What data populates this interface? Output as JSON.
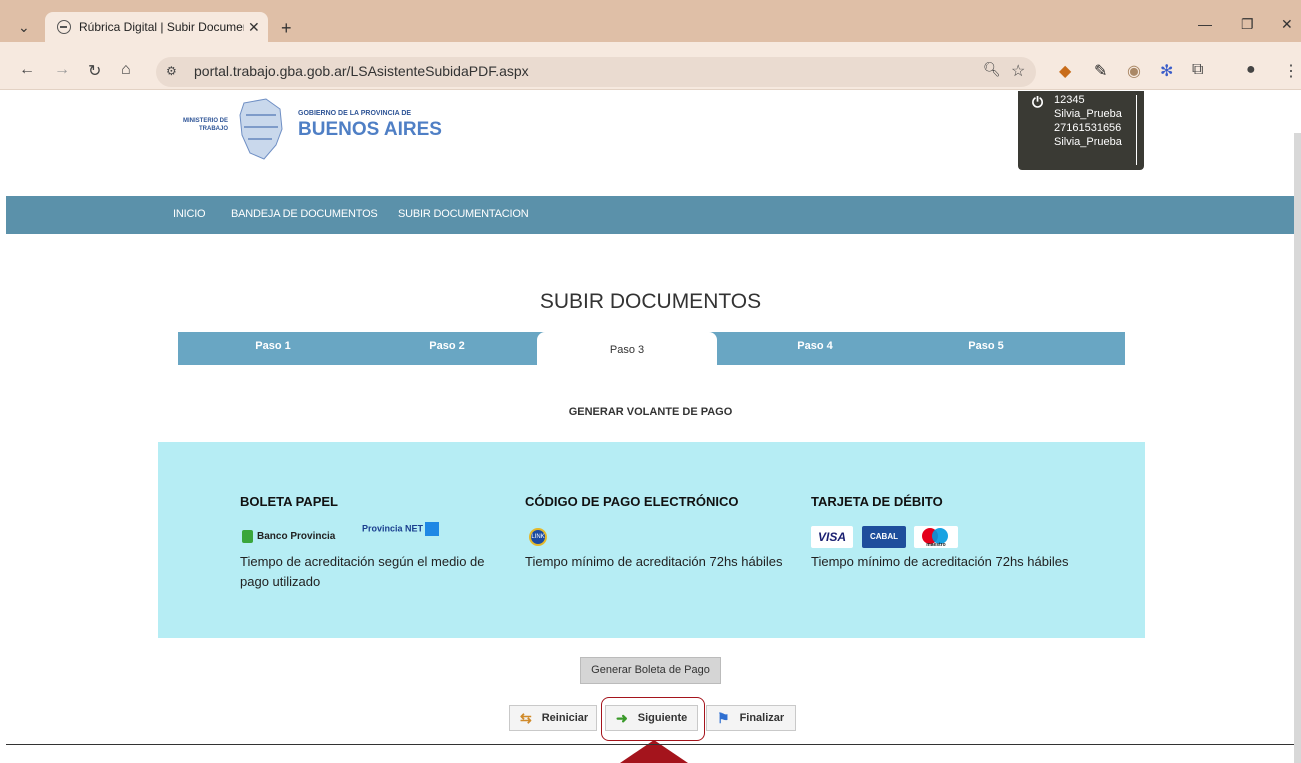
{
  "browser": {
    "tab_title": "Rúbrica Digital | Subir Documen",
    "url": "portal.trabajo.gba.gob.ar/LSAsistenteSubidaPDF.aspx"
  },
  "header": {
    "ministry": "MINISTERIO DE TRABAJO",
    "gov_small": "GOBIERNO DE LA PROVINCIA DE",
    "gov_big": "BUENOS AIRES"
  },
  "user": {
    "id": "12345",
    "name": "Silvia_Prueba",
    "cuit": "27161531656",
    "name2": "Silvia_Prueba"
  },
  "nav": [
    "INICIO",
    "BANDEJA DE DOCUMENTOS",
    "SUBIR DOCUMENTACION"
  ],
  "main": {
    "heading": "SUBIR DOCUMENTOS",
    "steps": [
      "Paso 1",
      "Paso 2",
      "Paso 3",
      "Paso 4",
      "Paso 5"
    ],
    "active_step": 3,
    "subtitle": "GENERAR VOLANTE DE PAGO"
  },
  "payment": [
    {
      "title": "BOLETA PAPEL",
      "text": "Tiempo de acreditación según el medio de pago utilizado",
      "logos": [
        "Banco Provincia",
        "Provincia NET"
      ]
    },
    {
      "title": "CÓDIGO DE PAGO ELECTRÓNICO",
      "text": "Tiempo mínimo de acreditación 72hs hábiles",
      "logos": [
        "LINK"
      ]
    },
    {
      "title": "TARJETA DE DÉBITO",
      "text": "Tiempo mínimo de acreditación 72hs hábiles",
      "logos": [
        "VISA",
        "CABAL",
        "maestro"
      ]
    }
  ],
  "actions": {
    "generate": "Generar Boleta de Pago",
    "restart": "Reiniciar",
    "next": "Siguiente",
    "finish": "Finalizar"
  },
  "colors": {
    "nav": "#5b91aa",
    "steps": "#69a6c3",
    "panel": "#b6edf4",
    "highlight": "#a4141c"
  }
}
